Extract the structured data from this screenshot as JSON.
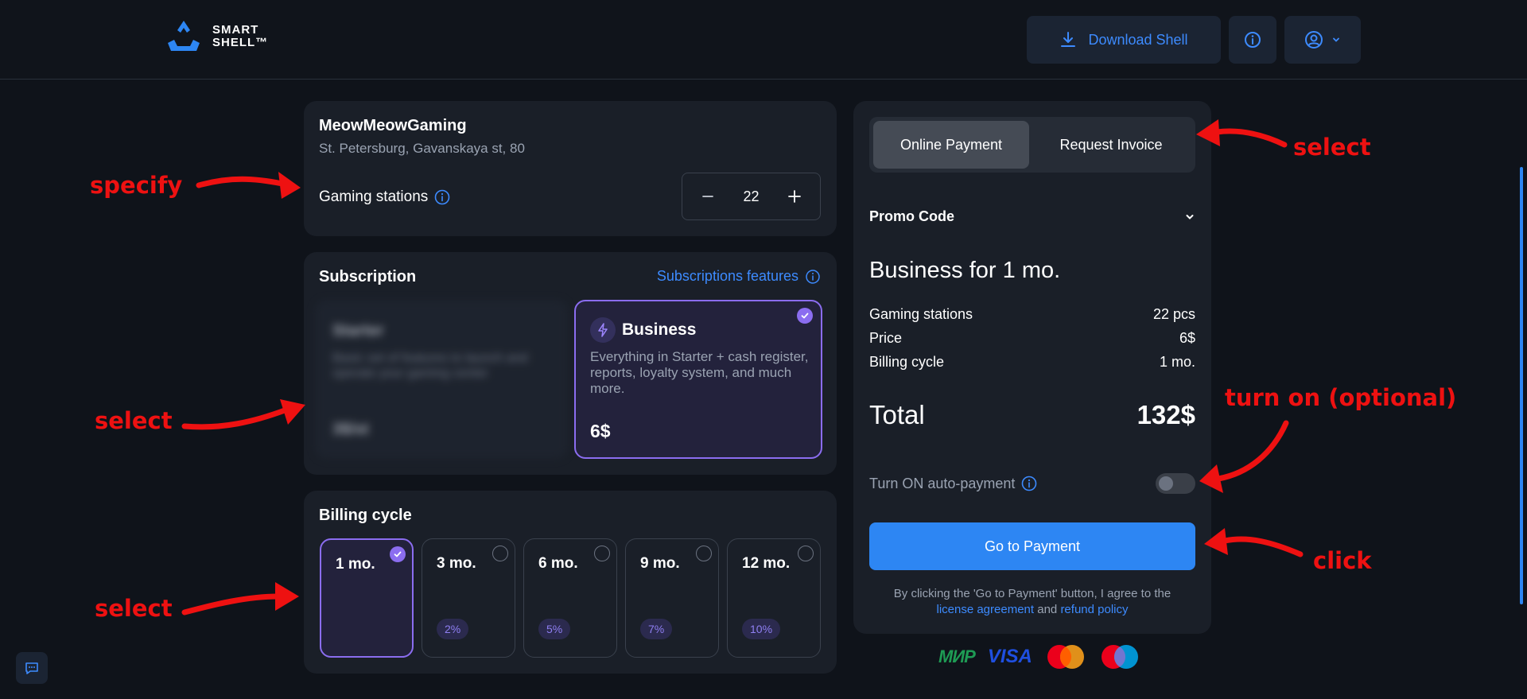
{
  "header": {
    "logo_line1": "SMART",
    "logo_line2": "SHELL™",
    "download_label": "Download Shell"
  },
  "club": {
    "name": "MeowMeowGaming",
    "address": "St. Petersburg, Gavanskaya st, 80",
    "stations_label": "Gaming stations",
    "stations_value": "22"
  },
  "subscription": {
    "title": "Subscription",
    "features_link": "Subscriptions features",
    "plans": [
      {
        "name": "Starter",
        "description": "Basic set of features to launch and operate your gaming center",
        "price": "3$/st",
        "selected": false,
        "obscured": true
      },
      {
        "name": "Business",
        "description": "Everything in Starter + cash register, reports, loyalty system, and much more.",
        "price": "6$",
        "selected": true
      }
    ]
  },
  "billing": {
    "title": "Billing cycle",
    "options": [
      {
        "label": "1 mo.",
        "discount": "",
        "selected": true
      },
      {
        "label": "3 mo.",
        "discount": "2%",
        "selected": false
      },
      {
        "label": "6 mo.",
        "discount": "5%",
        "selected": false
      },
      {
        "label": "9 mo.",
        "discount": "7%",
        "selected": false
      },
      {
        "label": "12 mo.",
        "discount": "10%",
        "selected": false
      }
    ]
  },
  "payment": {
    "tabs": [
      {
        "label": "Online Payment",
        "active": true
      },
      {
        "label": "Request Invoice",
        "active": false
      }
    ],
    "promo_label": "Promo Code",
    "summary_title": "Business for 1 mo.",
    "rows": [
      {
        "label": "Gaming stations",
        "value": "22 pcs"
      },
      {
        "label": "Price",
        "value": "6$"
      },
      {
        "label": "Billing cycle",
        "value": "1 mo."
      }
    ],
    "total_label": "Total",
    "total_value": "132$",
    "autopay_label": "Turn ON auto-payment",
    "autopay_on": false,
    "go_button": "Go to Payment",
    "terms_prefix": "By clicking the 'Go to Payment' button, I agree to the",
    "terms_link1": "license agreement",
    "terms_and": "and",
    "terms_link2": "refund policy"
  },
  "payment_logos": {
    "mir": "МИР",
    "visa": "VISA"
  },
  "annotations": {
    "specify": "specify",
    "select_plan": "select",
    "select_cycle": "select",
    "select_tab": "select",
    "turn_on": "turn on (optional)",
    "click": "click"
  },
  "colors": {
    "accent": "#2d86f3",
    "selection": "#8b6df0",
    "annotation": "#ee1111",
    "background": "#0f131a",
    "card": "#1a1f28"
  }
}
